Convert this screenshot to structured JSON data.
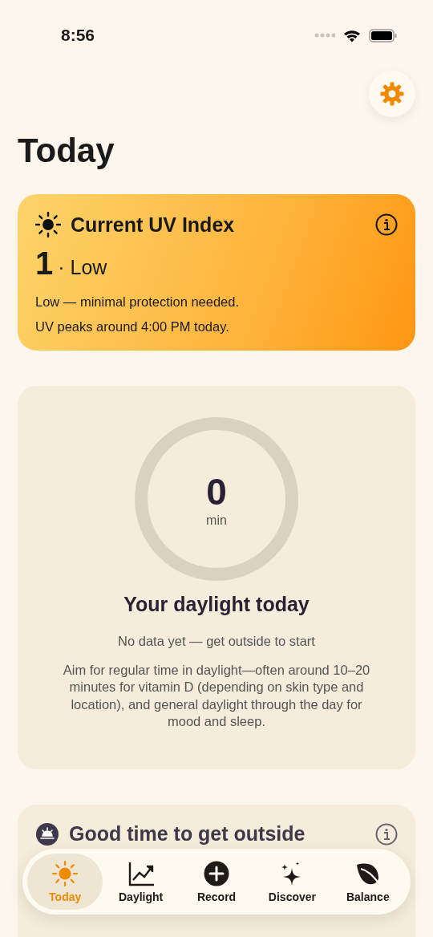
{
  "status_bar": {
    "time": "8:56"
  },
  "title": "Today",
  "uv_card": {
    "title": "Current UV Index",
    "value": "1",
    "level_label": "· Low",
    "lines": [
      "Low — minimal protection needed.",
      "UV peaks around 4:00 PM today."
    ]
  },
  "daylight_card": {
    "ring": {
      "value": "0",
      "unit": "min"
    },
    "title": "Your daylight today",
    "status": "No data yet — get outside to start",
    "body": "Aim for regular time in daylight—often around 10–20 minutes for vitamin D (depending on skin type and location), and general daylight through the day for mood and sleep."
  },
  "outside_card": {
    "title": "Good time to get outside"
  },
  "tabs": [
    {
      "label": "Today",
      "kind": "sun",
      "selected": true
    },
    {
      "label": "Daylight",
      "kind": "chart",
      "selected": false
    },
    {
      "label": "Record",
      "kind": "plus",
      "selected": false
    },
    {
      "label": "Discover",
      "kind": "sparkle",
      "selected": false
    },
    {
      "label": "Balance",
      "kind": "leaf",
      "selected": false
    }
  ]
}
